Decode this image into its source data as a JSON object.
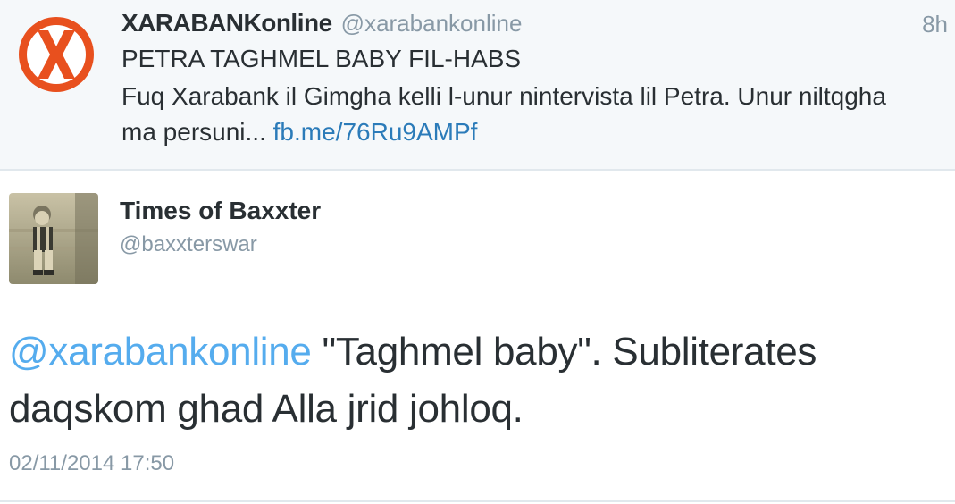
{
  "parent_tweet": {
    "display_name": "XARABANKonline",
    "handle": "@xarabankonline",
    "time_ago": "8h",
    "headline": "PETRA TAGHMEL BABY FIL-HABS",
    "body_text": "Fuq Xarabank il Gimgha kelli l-unur nintervista lil Petra. Unur niltqgha ma persuni...",
    "link_text": "fb.me/76Ru9AMPf",
    "avatar_icon": "orange-x-logo-icon",
    "avatar_color": "#e8501e"
  },
  "reply_tweet": {
    "display_name": "Times of Baxxter",
    "handle": "@baxxterswar",
    "avatar_icon": "vintage-photo-child-avatar",
    "mention": "@xarabankonline",
    "text_line1": " \"Taghmel baby\". Subliterates",
    "text_line2": "daqskom ghad Alla jrid johloq.",
    "timestamp": "02/11/2014 17:50"
  },
  "colors": {
    "link": "#2b7bb9",
    "mention": "#55acee",
    "muted": "#8899a6",
    "text": "#292f33",
    "parent_bg": "#f5f8fa"
  }
}
